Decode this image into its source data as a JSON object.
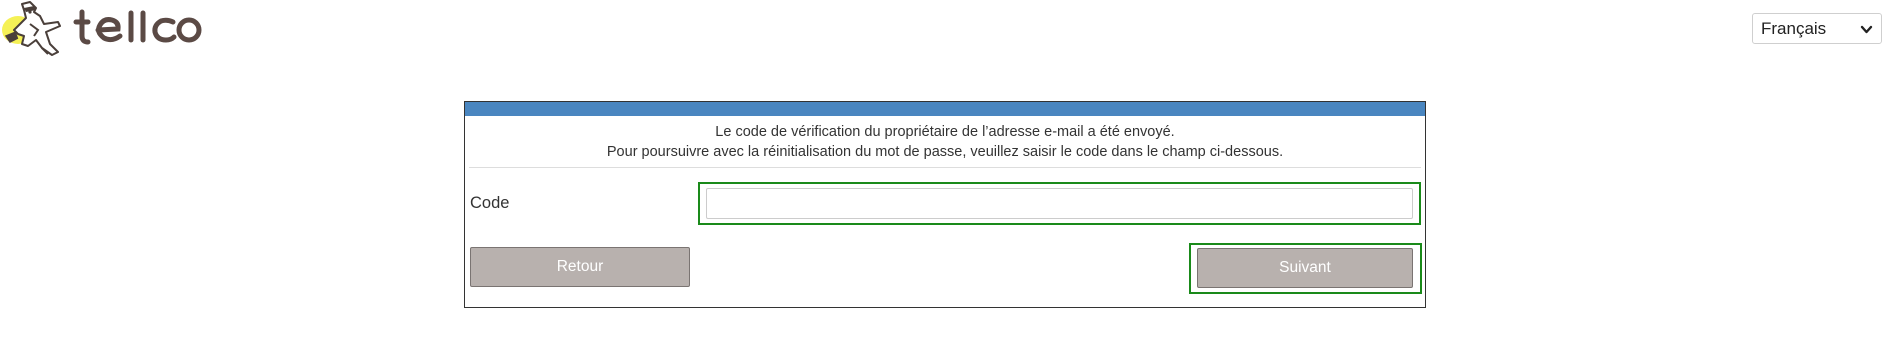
{
  "brand": {
    "name": "tellco",
    "logo_icon": "mascot-figure-icon",
    "accent_color": "#4a86c0",
    "text_color": "#5b4a45"
  },
  "language_select": {
    "value": "Français",
    "icon": "chevron-down-icon"
  },
  "panel": {
    "message_line1": "Le code de vérification du propriétaire de l’adresse e-mail a été envoyé.",
    "message_line2": "Pour poursuivre avec la réinitialisation du mot de passe, veuillez saisir le code dans le champ ci-dessous.",
    "code_label": "Code",
    "code_value": "",
    "back_label": "Retour",
    "next_label": "Suivant"
  }
}
